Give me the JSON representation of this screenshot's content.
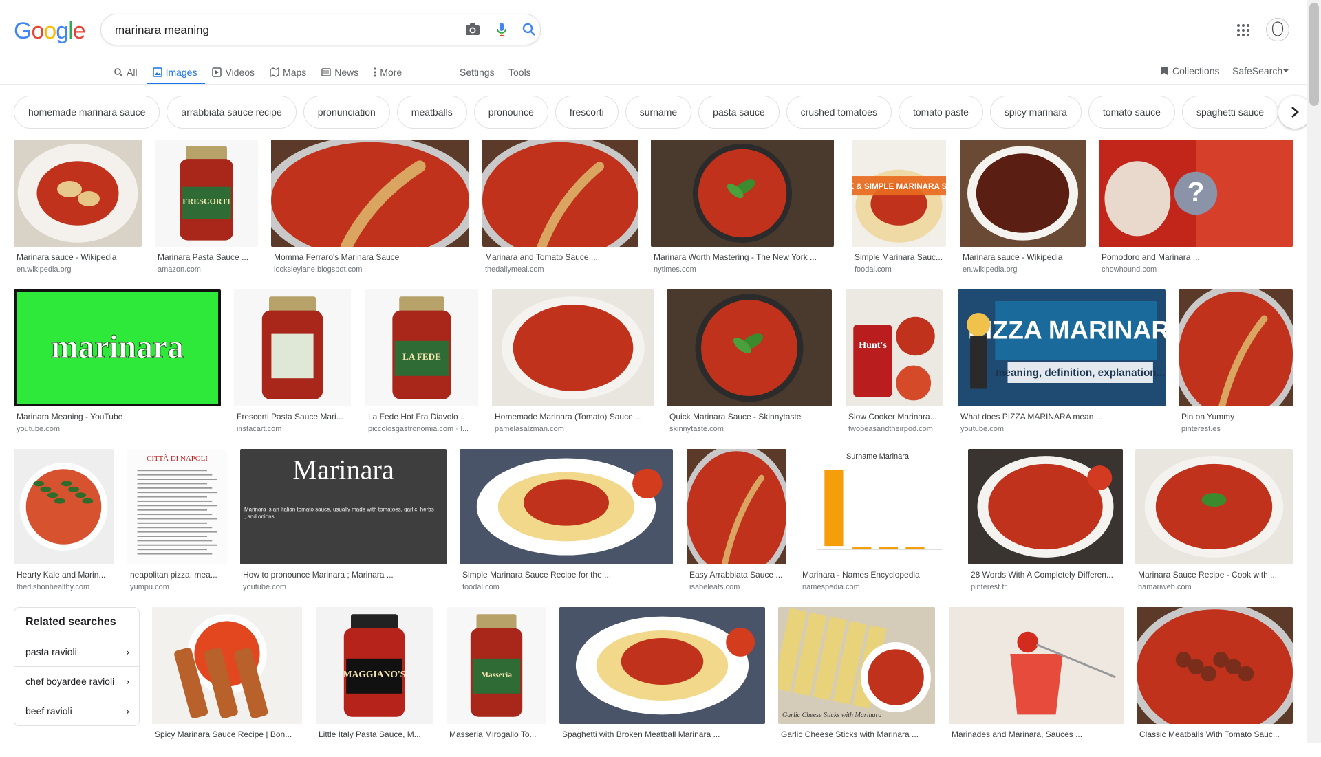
{
  "logo": {
    "letters": [
      "G",
      "o",
      "o",
      "g",
      "l",
      "e"
    ]
  },
  "search": {
    "query": "marinara meaning"
  },
  "tabs": [
    {
      "label": "All",
      "icon": "search-icon"
    },
    {
      "label": "Images",
      "icon": "image-icon",
      "active": true
    },
    {
      "label": "Videos",
      "icon": "video-icon"
    },
    {
      "label": "Maps",
      "icon": "map-icon"
    },
    {
      "label": "News",
      "icon": "news-icon"
    },
    {
      "label": "More",
      "icon": "more-vert-icon"
    }
  ],
  "tools": {
    "settings": "Settings",
    "tools": "Tools",
    "collections": "Collections",
    "safesearch": "SafeSearch"
  },
  "chips": [
    "homemade marinara sauce",
    "arrabbiata sauce recipe",
    "pronunciation",
    "meatballs",
    "pronounce",
    "frescorti",
    "surname",
    "pasta sauce",
    "crushed tomatoes",
    "tomato paste",
    "spicy marinara",
    "tomato sauce",
    "spaghetti sauce"
  ],
  "colors": {
    "accent": "#1a73e8",
    "sauce": "#c0321b",
    "caption": "#3c4043",
    "source": "#70757a"
  },
  "rows": [
    [
      {
        "title": "Marinara sauce - Wikipedia",
        "source": "en.wikipedia.org",
        "kind": "plate"
      },
      {
        "title": "Marinara Pasta Sauce ...",
        "source": "amazon.com",
        "kind": "jar-red",
        "label": "FRESCORTI"
      },
      {
        "title": "Momma Ferraro's Marinara Sauce",
        "source": "locksleylane.blogspot.com",
        "kind": "pot-spoon"
      },
      {
        "title": "Marinara and Tomato Sauce ...",
        "source": "thedailymeal.com",
        "kind": "pot-spoon"
      },
      {
        "title": "Marinara Worth Mastering - The New York ...",
        "source": "nytimes.com",
        "kind": "pan-basil"
      },
      {
        "title": "Simple Marinara Sauc...",
        "source": "foodal.com",
        "kind": "banner-pasta",
        "label": "QUICK & SIMPLE MARINARA SAUCE"
      },
      {
        "title": "Marinara sauce - Wikipedia",
        "source": "en.wikipedia.org",
        "kind": "bowl-dark"
      },
      {
        "title": "Pomodoro and Marinara ...",
        "source": "chowhound.com",
        "kind": "question",
        "label": "?"
      }
    ],
    [
      {
        "title": "Marinara Meaning - YouTube",
        "source": "youtube.com",
        "kind": "green-word",
        "label": "marinara"
      },
      {
        "title": "Frescorti Pasta Sauce Mari...",
        "source": "instacart.com",
        "kind": "jar-back"
      },
      {
        "title": "La Fede Hot Fra Diavolo ...",
        "source": "piccolosgastronomia.com · I...",
        "kind": "jar-red",
        "label": "LA FEDE"
      },
      {
        "title": "Homemade Marinara (Tomato) Sauce ...",
        "source": "pamelasalzman.com",
        "kind": "bowl"
      },
      {
        "title": "Quick Marinara Sauce - Skinnytaste",
        "source": "skinnytaste.com",
        "kind": "pan-basil"
      },
      {
        "title": "Slow Cooker Marinara...",
        "source": "twopeasandtheirpod.com",
        "kind": "can-bowl",
        "label": "Hunt's"
      },
      {
        "title": "What does PIZZA MARINARA mean ...",
        "source": "youtube.com",
        "kind": "pizza-title",
        "label": "PIZZA MARINARA",
        "label2": "meaning, definition, explanation..."
      },
      {
        "title": "Pin on Yummy",
        "source": "pinterest.es",
        "kind": "pot-spoon"
      }
    ],
    [
      {
        "title": "Hearty Kale and Marin...",
        "source": "thedishonhealthy.com",
        "kind": "pasta-kale"
      },
      {
        "title": "neapolitan pizza, mea...",
        "source": "yumpu.com",
        "kind": "document",
        "label": "CITTÀ DI NAPOLI"
      },
      {
        "title": "How to pronounce Marinara ; Marinara ...",
        "source": "youtube.com",
        "kind": "dark-title",
        "label": "Marinara",
        "label2": "Marinara is an Italian tomato sauce, usually made with tomatoes, garlic, herbs, and onions"
      },
      {
        "title": "Simple Marinara Sauce Recipe for the ...",
        "source": "foodal.com",
        "kind": "spaghetti"
      },
      {
        "title": "Easy Arrabbiata Sauce ...",
        "source": "isabeleats.com",
        "kind": "pot-spoon"
      },
      {
        "title": "Marinara - Names Encyclopedia",
        "source": "namespedia.com",
        "kind": "bar-chart",
        "label": "Surname Marinara"
      },
      {
        "title": "28 Words With A Completely Differen...",
        "source": "pinterest.fr",
        "kind": "bowl-tomato"
      },
      {
        "title": "Marinara Sauce Recipe - Cook with ...",
        "source": "hamariweb.com",
        "kind": "bowl-basil"
      }
    ],
    [
      {
        "title": "Spicy Marinara Sauce Recipe | Bon...",
        "source": "",
        "kind": "sticks"
      },
      {
        "title": "Little Italy Pasta Sauce, M...",
        "source": "",
        "kind": "jar-black",
        "label": "MAGGIANO'S"
      },
      {
        "title": "Masseria Mirogallo To...",
        "source": "",
        "kind": "jar-red",
        "label": "Masseria"
      },
      {
        "title": "Spaghetti with Broken Meatball Marinara ...",
        "source": "",
        "kind": "spaghetti"
      },
      {
        "title": "Garlic Cheese Sticks with Marinara ...",
        "source": "",
        "kind": "bread",
        "label": "Garlic Cheese Sticks with Marinara"
      },
      {
        "title": "Marinades and Marinara, Sauces ...",
        "source": "",
        "kind": "glass"
      },
      {
        "title": "Classic Meatballs With Tomato Sauc...",
        "source": "",
        "kind": "pot-meatballs"
      }
    ]
  ],
  "related": {
    "heading": "Related searches",
    "items": [
      "pasta ravioli",
      "chef boyardee ravioli",
      "beef ravioli"
    ]
  }
}
